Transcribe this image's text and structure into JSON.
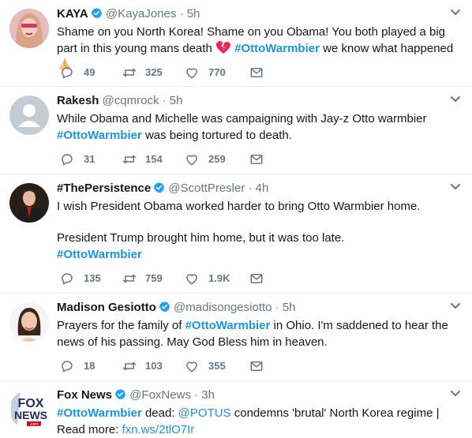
{
  "tweets": [
    {
      "name": "KAYA",
      "handle": "@KayaJones",
      "dot": "·",
      "time": "5h",
      "verified": true,
      "text_before": "Shame on you North Korea! Shame on you Obama! You both played a big part in this young mans death",
      "hashtag": "#OttoWarmbier",
      "text_after": " we know what happened",
      "emoji_after_death": "broken-heart-icon",
      "emoji_end": "praying-hands-icon",
      "replies": "49",
      "retweets": "325",
      "likes": "770"
    },
    {
      "name": "Rakesh",
      "handle": "@cqmrock",
      "dot": "·",
      "time": "5h",
      "verified": false,
      "text_line1": "While Obama and Michelle was campaigning with Jay-z Otto warmbier",
      "hashtag": "#OttoWarmbier",
      "text_after": " was being tortured to death.",
      "replies": "31",
      "retweets": "154",
      "likes": "259"
    },
    {
      "name": "#ThePersistence",
      "handle": "@ScottPresler",
      "dot": "·",
      "time": "4h",
      "verified": true,
      "para1": "I wish President Obama worked harder to bring Otto Warmbier home.",
      "para2": "President Trump brought him home, but it was too late.",
      "hashtag": "#OttoWarmbier",
      "replies": "135",
      "retweets": "759",
      "likes": "1.9K"
    },
    {
      "name": "Madison Gesiotto",
      "handle": "@madisongesiotto",
      "dot": "·",
      "time": "5h",
      "verified": true,
      "text_before": "Prayers for the family of ",
      "hashtag": "#OttoWarmbier",
      "text_after": " in Ohio. I'm saddened to hear the news of his passing. May God Bless him in heaven.",
      "replies": "18",
      "retweets": "103",
      "likes": "355"
    },
    {
      "name": "Fox News",
      "handle": "@FoxNews",
      "dot": "·",
      "time": "3h",
      "verified": true,
      "hashtag": "#OttoWarmbier",
      "text_mid": " dead: ",
      "mention": "@POTUS",
      "text_after": " condemns 'brutal' North Korea regime | Read more: ",
      "link": "fxn.ws/2tlO7Ir",
      "logo_text_top": "FOX",
      "logo_text_bottom": "NEWS",
      "logo_text_small": ".com"
    }
  ],
  "colors": {
    "link": "#1b95e0",
    "muted": "#657786",
    "text": "#14171a",
    "divider": "#e6ecf0",
    "verified": "#1da1f2"
  }
}
